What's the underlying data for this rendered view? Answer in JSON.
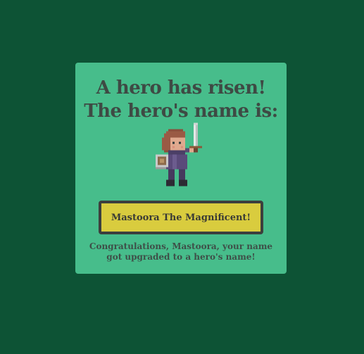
{
  "card": {
    "heading_line1": "A hero has risen!",
    "heading_line2": "The hero's name is:",
    "hero_name_button": "Mastoora The Magnificent!",
    "congrats_text": "Congratulations, Mastoora, your name got upgraded to a hero's name!",
    "sprite_icon": "pixel-knight-with-sword-and-shield"
  },
  "colors": {
    "background": "#0d5335",
    "card": "#47bd8b",
    "button": "#d9cc3e",
    "button_border": "#3c3f3d",
    "text": "#3e4a44"
  }
}
